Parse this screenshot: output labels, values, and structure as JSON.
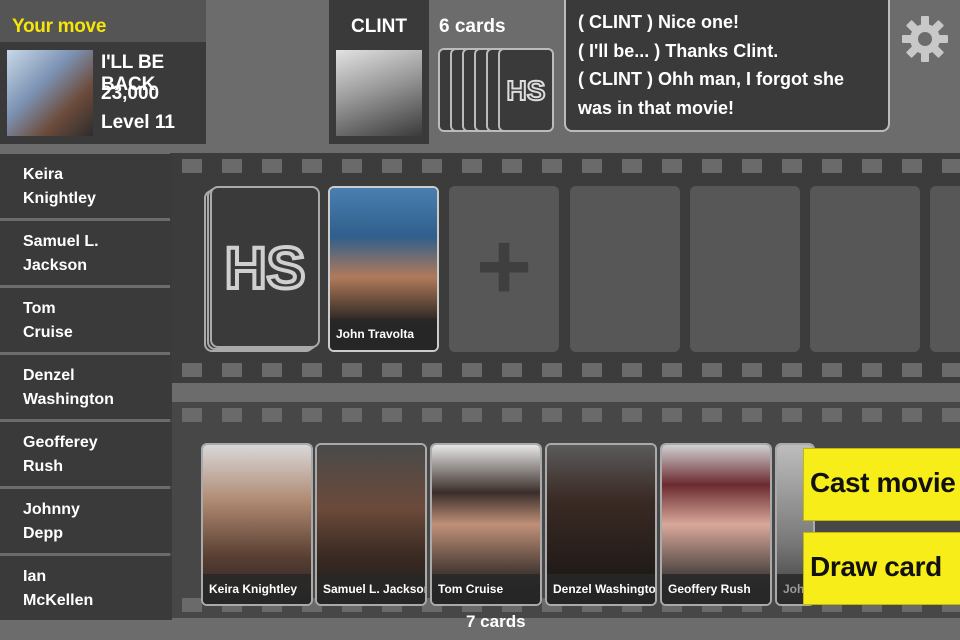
{
  "header": {
    "turn_label": "Your move",
    "player": {
      "name": "I'LL BE BACK",
      "score": "23,000",
      "level": "Level 11"
    },
    "opponent": {
      "name": "CLINT",
      "card_count": "6 cards"
    },
    "settings_icon": "gear-icon"
  },
  "chat": {
    "messages": [
      "( CLINT )  Nice one!",
      "( I'll be... )  Thanks Clint.",
      "( CLINT )  Ohh man, I forgot she was in that movie!"
    ]
  },
  "name_list": [
    "Keira\nKnightley",
    "Samuel L.\nJackson",
    "Tom\nCruise",
    "Denzel\nWashington",
    "Geofferey\nRush",
    "Johnny\nDepp",
    "Ian\nMcKellen"
  ],
  "board": {
    "deck_logo": "HS",
    "played_cards": [
      {
        "name": "John Travolta"
      }
    ],
    "add_icon": "plus-icon"
  },
  "hand": {
    "cards": [
      {
        "name": "Keira Knightley"
      },
      {
        "name": "Samuel L. Jackson"
      },
      {
        "name": "Tom Cruise"
      },
      {
        "name": "Denzel Washington"
      },
      {
        "name": "Geoffery Rush"
      },
      {
        "name": "Johnny Depp"
      }
    ],
    "count_label": "7 cards"
  },
  "actions": {
    "cast": "Cast movie",
    "draw": "Draw card"
  },
  "colors": {
    "accent_yellow": "#f7ee19",
    "turn_yellow": "#f5e50a",
    "panel": "#3a3a3a",
    "background": "#6c6c6c"
  }
}
